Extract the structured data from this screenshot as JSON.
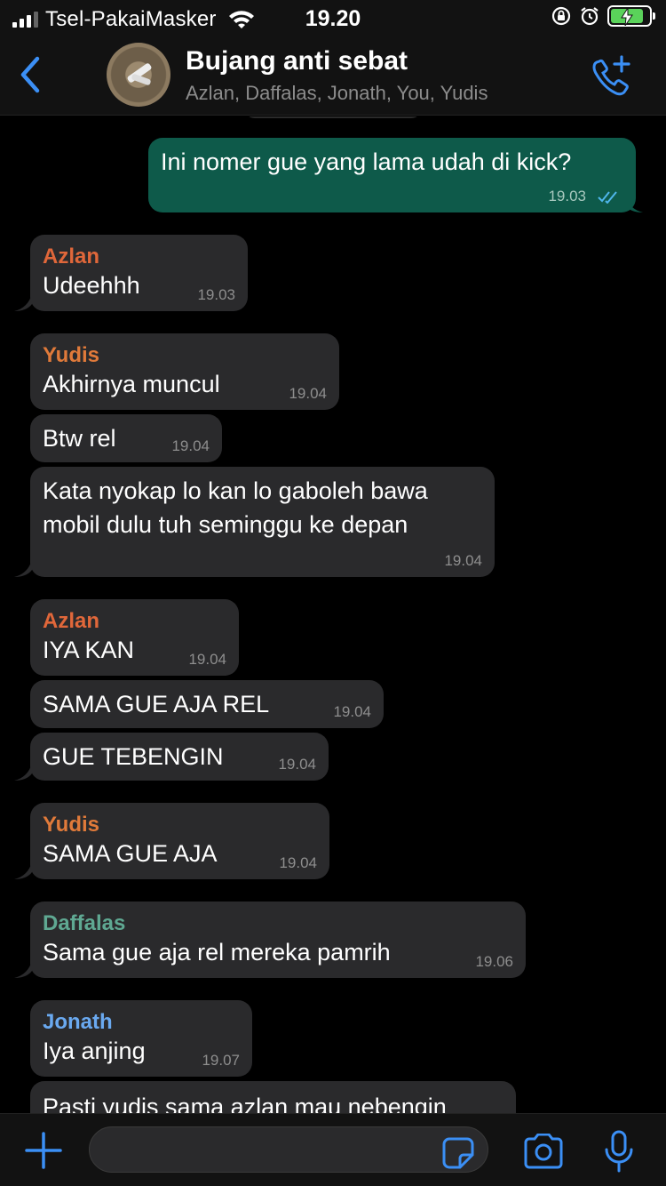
{
  "status_bar": {
    "carrier": "Tsel-PakaiMasker",
    "time": "19.20",
    "battery_level": 0.8
  },
  "header": {
    "title": "Bujang anti sebat",
    "subtitle": "Azlan, Daffalas, Jonath, You, Yudis"
  },
  "colors": {
    "accent": "#3b8ff5",
    "outgoing_bubble": "#0e5a4a",
    "incoming_bubble": "#2a2a2c",
    "azlan": "#e0673a",
    "yudis": "#e07a3a",
    "daffalas": "#5fa892",
    "jonath": "#6aa9f0"
  },
  "messages": [
    {
      "direction": "out",
      "text": "Ini nomer gue yang lama udah di kick?",
      "time": "19.03",
      "read": true
    },
    {
      "direction": "in",
      "sender": "Azlan",
      "text": "Udeehhh",
      "time": "19.03"
    },
    {
      "direction": "in",
      "sender": "Yudis",
      "text": "Akhirnya muncul",
      "time": "19.04"
    },
    {
      "direction": "in",
      "text": "Btw rel",
      "time": "19.04"
    },
    {
      "direction": "in",
      "text_lines": [
        "Kata nyokap lo kan lo gaboleh bawa",
        "mobil dulu tuh seminggu ke depan"
      ],
      "time": "19.04"
    },
    {
      "direction": "in",
      "sender": "Azlan",
      "text": "IYA KAN",
      "time": "19.04"
    },
    {
      "direction": "in",
      "text": "SAMA GUE AJA REL",
      "time": "19.04"
    },
    {
      "direction": "in",
      "text": "GUE TEBENGIN",
      "time": "19.04"
    },
    {
      "direction": "in",
      "sender": "Yudis",
      "text": "SAMA GUE AJA",
      "time": "19.04"
    },
    {
      "direction": "in",
      "sender": "Daffalas",
      "text": "Sama gue aja rel mereka pamrih",
      "time": "19.06"
    },
    {
      "direction": "in",
      "sender": "Jonath",
      "text": "Iya anjing",
      "time": "19.07"
    },
    {
      "direction": "in",
      "text": "Pasti yudis sama azlan mau nebengin"
    }
  ]
}
